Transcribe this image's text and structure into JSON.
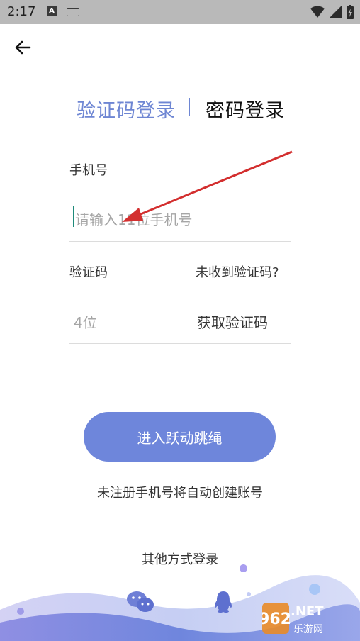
{
  "status_bar": {
    "time": "2:17",
    "a_icon": "A"
  },
  "tabs": {
    "sms_login": "验证码登录",
    "password_login": "密码登录"
  },
  "phone": {
    "label": "手机号",
    "placeholder": "请输入11位手机号"
  },
  "code": {
    "label": "验证码",
    "not_received": "未收到验证码?",
    "placeholder": "4位",
    "get_code": "获取验证码"
  },
  "submit_label": "进入跃动跳绳",
  "auto_create_hint": "未注册手机号将自动创建账号",
  "other_login": "其他方式登录",
  "watermark": {
    "brand": "962.NET",
    "sub": "乐游网"
  },
  "colors": {
    "accent": "#6e86db",
    "arrow": "#d32f2f"
  }
}
